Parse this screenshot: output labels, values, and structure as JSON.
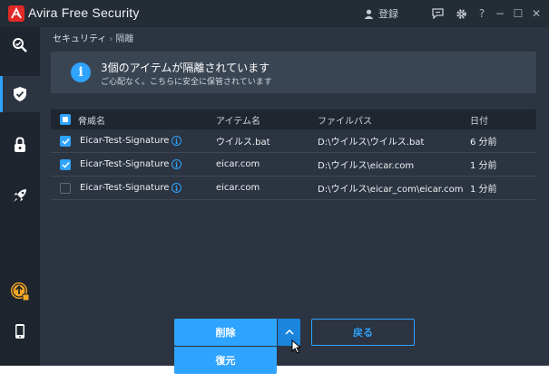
{
  "window": {
    "app_title": "Avira Free Security",
    "login_label": "登録",
    "help_glyph": "?",
    "minimize_glyph": "−",
    "maximize_glyph": "☐",
    "close_glyph": "✕"
  },
  "breadcrumb": {
    "parent": "セキュリティ",
    "separator": "›",
    "current": "隔離"
  },
  "banner": {
    "info_glyph": "i",
    "title": "3個のアイテムが隔離されています",
    "subtitle": "ご心配なく。こちらに安全に保管されています"
  },
  "table": {
    "headers": {
      "threat": "脅威名",
      "item": "アイテム名",
      "path": "ファイルパス",
      "date": "日付"
    },
    "rows": [
      {
        "checked": true,
        "threat": "Eicar-Test-Signature",
        "item": "ウイルス.bat",
        "path": "D:\\ウイルス\\ウイルス.bat",
        "date": "6 分前"
      },
      {
        "checked": true,
        "threat": "Eicar-Test-Signature",
        "item": "eicar.com",
        "path": "D:\\ウイルス\\eicar.com",
        "date": "1 分前"
      },
      {
        "checked": false,
        "threat": "Eicar-Test-Signature",
        "item": "eicar.com",
        "path": "D:\\ウイルス\\eicar_com\\eicar.com",
        "date": "1 分前"
      }
    ],
    "info_glyph": "i"
  },
  "actions": {
    "delete_label": "削除",
    "restore_label": "復元",
    "back_label": "戻る"
  },
  "sidebar": {
    "items": [
      {
        "icon": "scan-icon"
      },
      {
        "icon": "shield-check-icon",
        "active": true
      },
      {
        "icon": "lock-icon"
      },
      {
        "icon": "rocket-icon"
      },
      {
        "icon": "upgrade-icon"
      },
      {
        "icon": "mobile-icon"
      }
    ]
  },
  "colors": {
    "accent": "#2ea3ff",
    "background": "#2b3440",
    "sidebar": "#1e252e",
    "banner": "#3a4553",
    "upgrade_badge": "#f5a623"
  }
}
